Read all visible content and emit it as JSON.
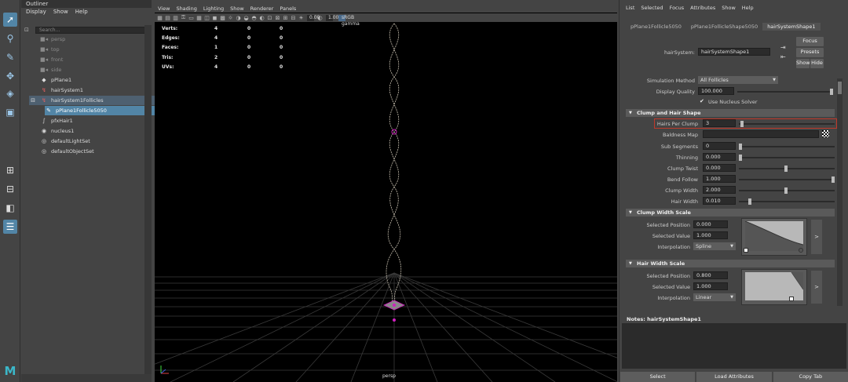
{
  "outliner": {
    "title": "Outliner",
    "menu": [
      "Display",
      "Show",
      "Help"
    ],
    "search_placeholder": "Search...",
    "items": [
      {
        "label": "persp",
        "icon": "camera-icon"
      },
      {
        "label": "top",
        "icon": "camera-icon"
      },
      {
        "label": "front",
        "icon": "camera-icon"
      },
      {
        "label": "side",
        "icon": "camera-icon"
      },
      {
        "label": "pPlane1",
        "icon": "mesh-icon"
      },
      {
        "label": "hairSystem1",
        "icon": "hair-system-icon"
      },
      {
        "label": "hairSystem1Follicles",
        "icon": "group-icon"
      },
      {
        "label": "pPlane1Follicle5050",
        "icon": "follicle-icon"
      },
      {
        "label": "pfxHair1",
        "icon": "pfx-hair-icon"
      },
      {
        "label": "nucleus1",
        "icon": "nucleus-icon"
      },
      {
        "label": "defaultLightSet",
        "icon": "set-icon"
      },
      {
        "label": "defaultObjectSet",
        "icon": "set-icon"
      }
    ]
  },
  "viewport": {
    "menu": [
      "View",
      "Shading",
      "Lighting",
      "Show",
      "Renderer",
      "Panels"
    ],
    "exposure": "0.00",
    "gamma": "1.00",
    "color_space": "sRGB gamma",
    "hud": [
      {
        "label": "Verts:",
        "a": "4",
        "b": "0",
        "c": "0"
      },
      {
        "label": "Edges:",
        "a": "4",
        "b": "0",
        "c": "0"
      },
      {
        "label": "Faces:",
        "a": "1",
        "b": "0",
        "c": "0"
      },
      {
        "label": "Tris:",
        "a": "2",
        "b": "0",
        "c": "0"
      },
      {
        "label": "UVs:",
        "a": "4",
        "b": "0",
        "c": "0"
      }
    ],
    "camera_label": "persp"
  },
  "attribute_editor": {
    "menu": [
      "List",
      "Selected",
      "Focus",
      "Attributes",
      "Show",
      "Help"
    ],
    "tabs": [
      "pPlane1Follicle5050",
      "pPlane1FollicleShape5050",
      "hairSystemShape1"
    ],
    "node_label": "hairSystem:",
    "node_value": "hairSystemShape1",
    "focus": "Focus",
    "presets": "Presets",
    "show": "Show",
    "hide": "Hide",
    "simulation_method_label": "Simulation Method",
    "simulation_method_value": "All Follicles",
    "display_quality_label": "Display Quality",
    "display_quality_value": "100.000",
    "use_nucleus_solver": "Use Nucleus Solver",
    "clump_section": "Clump and Hair Shape",
    "hairs_per_clump_label": "Hairs Per Clump",
    "hairs_per_clump_value": "3",
    "baldness_map_label": "Baldness Map",
    "sub_segments_label": "Sub Segments",
    "sub_segments_value": "0",
    "thinning_label": "Thinning",
    "thinning_value": "0.000",
    "clump_twist_label": "Clump Twist",
    "clump_twist_value": "0.000",
    "bend_follow_label": "Bend Follow",
    "bend_follow_value": "1.000",
    "clump_width_label": "Clump Width",
    "clump_width_value": "2.000",
    "hair_width_label": "Hair Width",
    "hair_width_value": "0.010",
    "clump_width_scale_section": "Clump Width Scale",
    "cws_selected_position_label": "Selected Position",
    "cws_selected_position_value": "0.000",
    "cws_selected_value_label": "Selected Value",
    "cws_selected_value_value": "1.000",
    "cws_interpolation_label": "Interpolation",
    "cws_interpolation_value": "Spline",
    "hair_width_scale_section": "Hair Width Scale",
    "hws_selected_position_label": "Selected Position",
    "hws_selected_position_value": "0.800",
    "hws_selected_value_label": "Selected Value",
    "hws_selected_value_value": "1.000",
    "hws_interpolation_label": "Interpolation",
    "hws_interpolation_value": "Linear",
    "expand_glyph": ">",
    "notes_label": "Notes:",
    "notes_node": "hairSystemShape1",
    "bottom_buttons": [
      "Select",
      "Load Attributes",
      "Copy Tab"
    ]
  },
  "colors": {
    "selection": "#5285a6",
    "highlight_box": "#c0392b",
    "locator": "#d020c0"
  }
}
